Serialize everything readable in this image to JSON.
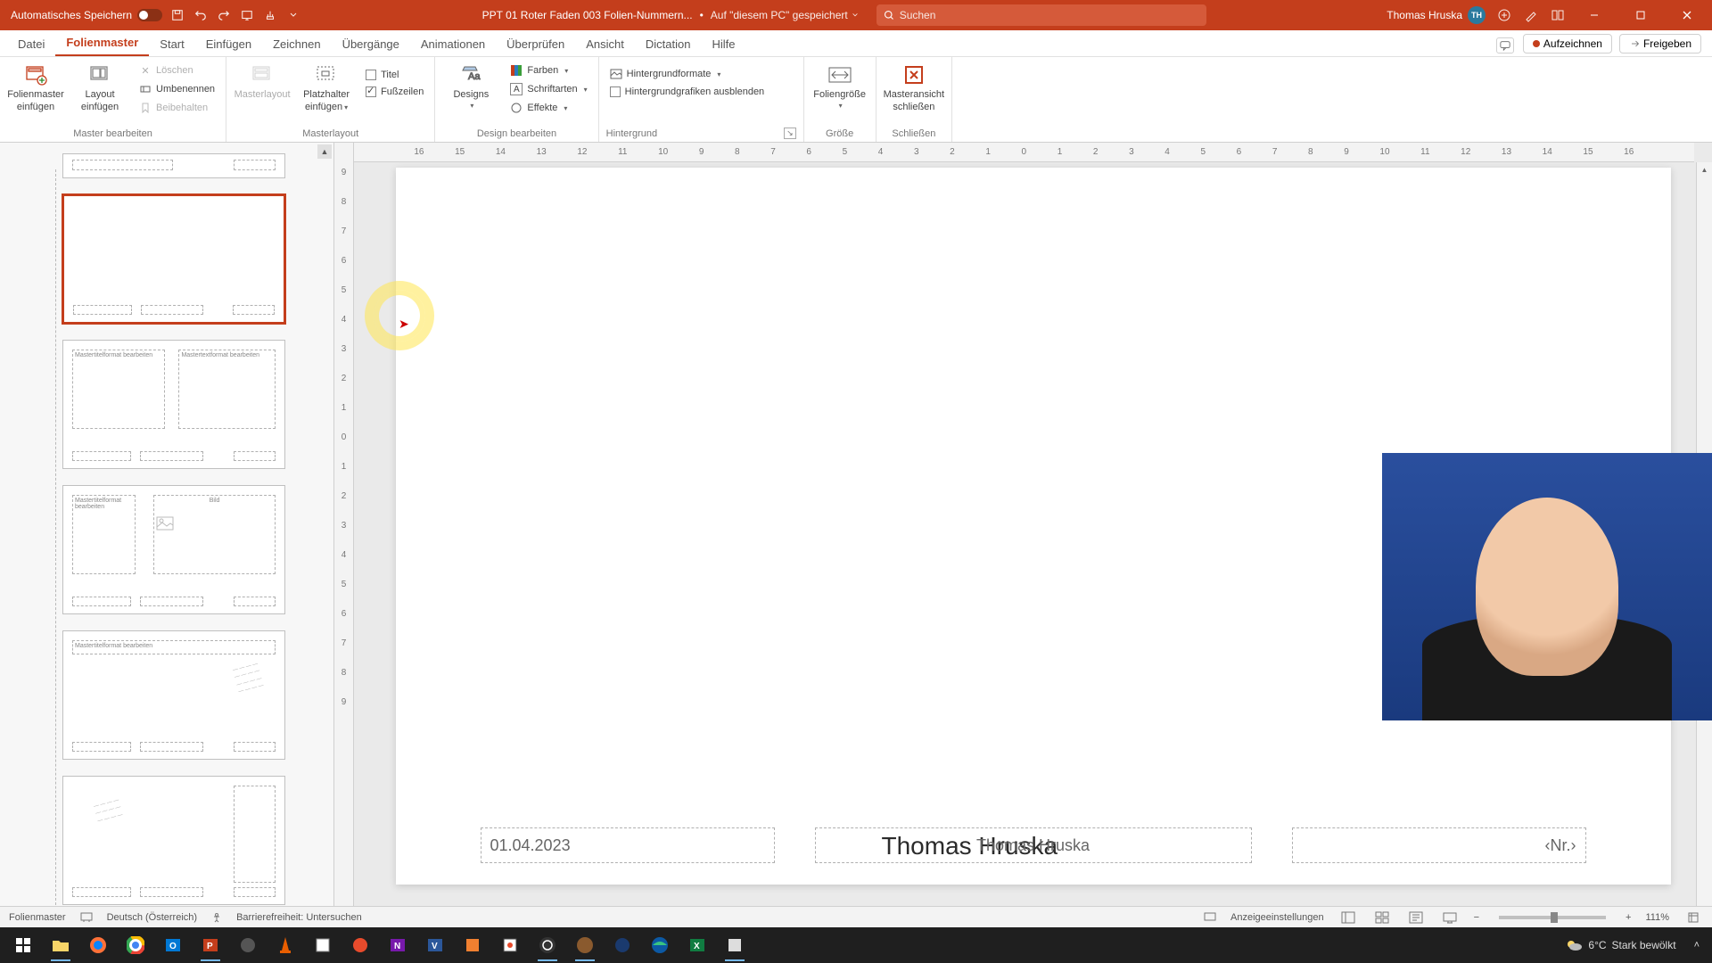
{
  "titlebar": {
    "autosave_label": "Automatisches Speichern",
    "doc_name": "PPT 01 Roter Faden 003 Folien-Nummern...",
    "saved_location": "Auf \"diesem PC\" gespeichert",
    "search_placeholder": "Suchen",
    "user_name": "Thomas Hruska",
    "user_initials": "TH"
  },
  "tabs": {
    "datei": "Datei",
    "folienmaster": "Folienmaster",
    "start": "Start",
    "einfuegen": "Einfügen",
    "zeichnen": "Zeichnen",
    "uebergaenge": "Übergänge",
    "animationen": "Animationen",
    "ueberpruefen": "Überprüfen",
    "ansicht": "Ansicht",
    "dictation": "Dictation",
    "hilfe": "Hilfe",
    "aufzeichnen": "Aufzeichnen",
    "freigeben": "Freigeben"
  },
  "ribbon": {
    "group_master": "Master bearbeiten",
    "folienmaster_einfuegen_l1": "Folienmaster",
    "folienmaster_einfuegen_l2": "einfügen",
    "layout_einfuegen_l1": "Layout",
    "layout_einfuegen_l2": "einfügen",
    "loeschen": "Löschen",
    "umbenennen": "Umbenennen",
    "beibehalten": "Beibehalten",
    "group_masterlayout": "Masterlayout",
    "masterlayout_btn": "Masterlayout",
    "platzhalter_l1": "Platzhalter",
    "platzhalter_l2": "einfügen",
    "titel": "Titel",
    "fusszeilen": "Fußzeilen",
    "group_design": "Design bearbeiten",
    "designs": "Designs",
    "farben": "Farben",
    "schriftarten": "Schriftarten",
    "effekte": "Effekte",
    "group_hintergrund": "Hintergrund",
    "hintergrundformate": "Hintergrundformate",
    "grafiken_ausblenden": "Hintergrundgrafiken ausblenden",
    "group_groesse": "Größe",
    "foliengroesse": "Foliengröße",
    "group_schliessen": "Schließen",
    "masteransicht_l1": "Masteransicht",
    "masteransicht_l2": "schließen"
  },
  "slide": {
    "presenter_name": "Thomas Hruska",
    "footer_date": "01.04.2023",
    "footer_center": "Thomas Hruska",
    "footer_num": "‹Nr.›"
  },
  "thumbnails": {
    "t3_title": "Mastertitelformat bearbeiten",
    "t3_content": "Mastertextformat bearbeiten",
    "t4_title": "Mastertitelformat bearbeiten",
    "t4_pic": "Bild",
    "t5_title": "Mastertitelformat bearbeiten"
  },
  "ruler_h": [
    "16",
    "15",
    "14",
    "13",
    "12",
    "11",
    "10",
    "9",
    "8",
    "7",
    "6",
    "5",
    "4",
    "3",
    "2",
    "1",
    "0",
    "1",
    "2",
    "3",
    "4",
    "5",
    "6",
    "7",
    "8",
    "9",
    "10",
    "11",
    "12",
    "13",
    "14",
    "15",
    "16"
  ],
  "ruler_v": [
    "9",
    "8",
    "7",
    "6",
    "5",
    "4",
    "3",
    "2",
    "1",
    "0",
    "1",
    "2",
    "3",
    "4",
    "5",
    "6",
    "7",
    "8",
    "9"
  ],
  "status": {
    "mode": "Folienmaster",
    "language": "Deutsch (Österreich)",
    "accessibility": "Barrierefreiheit: Untersuchen",
    "display_settings": "Anzeigeeinstellungen",
    "zoom": "111%"
  },
  "taskbar": {
    "temp": "6°C",
    "weather": "Stark bewölkt"
  }
}
